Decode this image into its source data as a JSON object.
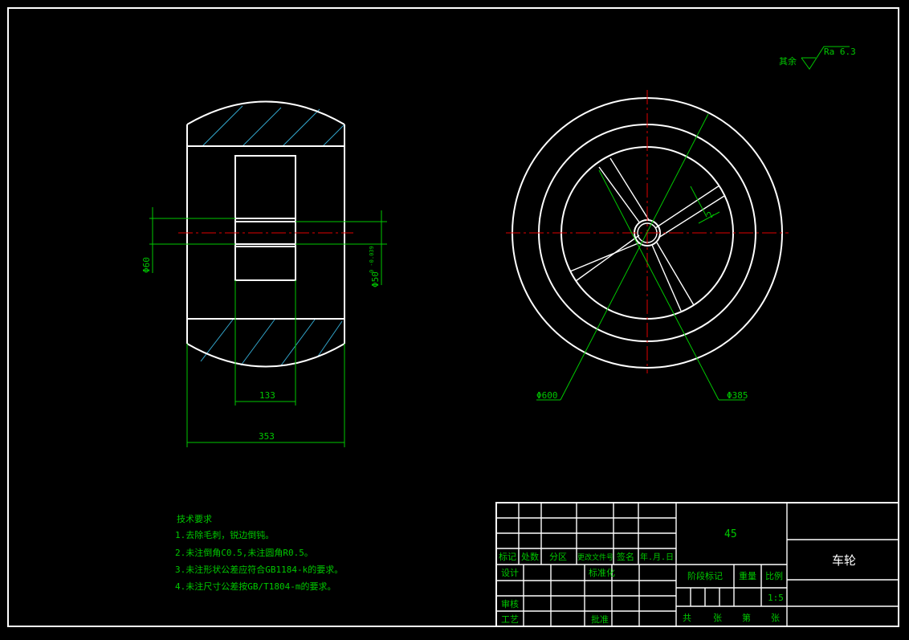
{
  "surface_note": {
    "prefix": "其余",
    "roughness": "Ra 6.3"
  },
  "dimensions": {
    "d60": "Φ60",
    "d50": "Φ50",
    "d50_tol": "0 -0.039",
    "len133": "133",
    "len353": "353",
    "d600": "Φ600",
    "d385": "Φ385",
    "spoke": "2"
  },
  "notes": {
    "title": "技术要求",
    "items": [
      "1.去除毛刺，锐边倒钝。",
      "2.未注倒角C0.5,未注圆角R0.5。",
      "3.未注形状公差应符合GB1184-k的要求。",
      "4.未注尺寸公差按GB/T1804-m的要求。"
    ]
  },
  "title_block": {
    "material": "45",
    "part_name": "车轮",
    "rev_headers": [
      "标记",
      "处数",
      "分区",
      "更改文件号",
      "签名",
      "年.月.日"
    ],
    "design": "设计",
    "standardize": "标准化",
    "review": "审核",
    "process": "工艺",
    "approve": "批准",
    "stage_mark": "阶段标记",
    "weight": "重量",
    "scale_label": "比例",
    "scale_value": "1:5",
    "total": "共",
    "sheet": "张",
    "num": "第",
    "sheet2": "张"
  },
  "colors": {
    "background": "#000000",
    "outline": "#ffffff",
    "dimension": "#00c800",
    "centerline": "#e00000",
    "hatch": "#33a6cc"
  }
}
